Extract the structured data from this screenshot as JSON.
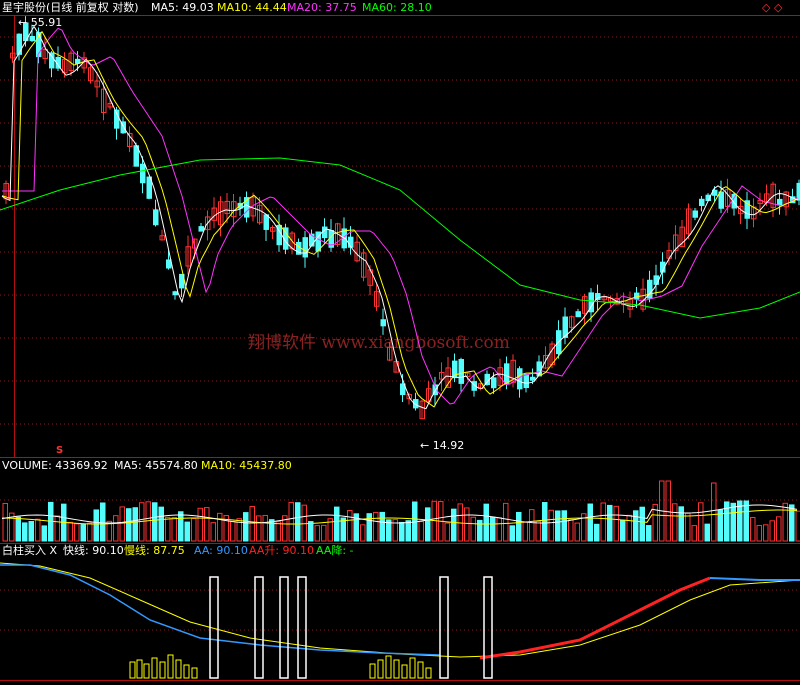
{
  "header": {
    "title": "星宇股份(日线 前复权 对数)",
    "ma": [
      {
        "label": "MA5: 49.03",
        "color": "#ffffff"
      },
      {
        "label": "MA10: 44.44",
        "color": "#ffff00"
      },
      {
        "label": "MA20: 37.75",
        "color": "#ff33ff"
      },
      {
        "label": "MA60: 28.10",
        "color": "#00ff00"
      }
    ],
    "corner_icons": "◇ ◇"
  },
  "price_panel": {
    "high_marker": "55.91",
    "low_marker": "14.92",
    "signal_glyph": "S",
    "watermark": "翔博软件 www.xiangbosoft.com"
  },
  "volume_panel": {
    "label": "VOLUME: 43369.92",
    "ma5": "MA5: 45574.80",
    "ma10": "MA10: 45437.80"
  },
  "indicator_panel": {
    "name": "白柱买入",
    "close_glyph": "X",
    "items": [
      {
        "label": "快线: 90.10",
        "color": "#ffffff"
      },
      {
        "label": "慢线: 87.75",
        "color": "#ffff00"
      },
      {
        "label": "AA: 90.10",
        "color": "#3399ff"
      },
      {
        "label": "AA升: 90.10",
        "color": "#ff2222"
      },
      {
        "label": "AA降: -",
        "color": "#00ff00"
      }
    ]
  },
  "colors": {
    "up": "#ff3232",
    "down": "#54fcfc",
    "ma5": "#ffffff",
    "ma10": "#ffff00",
    "ma20": "#ff33ff",
    "ma60": "#00ff00",
    "grid": "#8a1a1a",
    "watermark": "#8b2222"
  }
}
